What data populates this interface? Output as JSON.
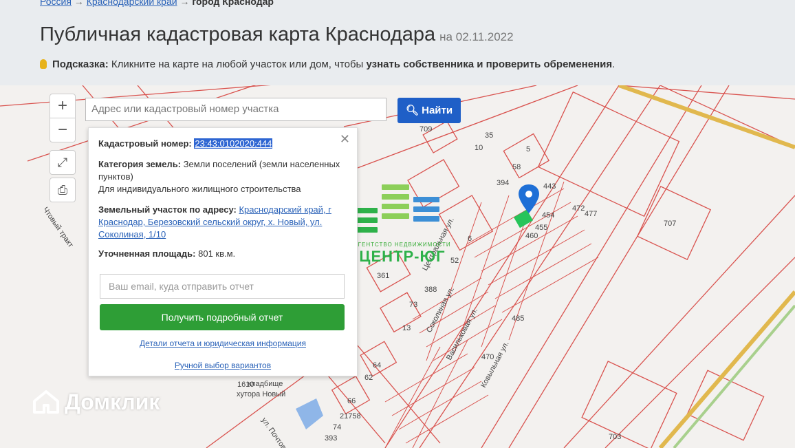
{
  "breadcrumb": {
    "part1": "Россия",
    "arrow1": " → ",
    "part2": "Краснодарский край",
    "arrow2": " → ",
    "part3": "город Краснодар"
  },
  "header": {
    "title": "Публичная кадастровая карта Краснодара",
    "date": "на 02.11.2022"
  },
  "hint": {
    "label": "Подсказка:",
    "text": "Кликните на карте на любой участок или дом, чтобы ",
    "bold": "узнать собственника и проверить обременения",
    "tail": "."
  },
  "map_controls": {
    "zoom_in": "+",
    "zoom_out": "−"
  },
  "search": {
    "placeholder": "Адрес или кадастровый номер участка",
    "button": "Найти"
  },
  "popup": {
    "cadastral_label": "Кадастровый номер:",
    "cadastral_value": "23:43:0102020:444",
    "category_label": "Категория земель:",
    "category_value": "Земли поселений (земли населенных пунктов)",
    "category_use": "Для индивидуального жилищного строительства",
    "address_label": "Земельный участок по адресу:",
    "address_value": "Краснодарский край, г Краснодар, Березовский сельский округ, х. Новый, ул. Соколиная, 1/10",
    "area_label": "Уточненная площадь:",
    "area_value": "801 кв.м.",
    "email_placeholder": "Ваш email, куда отправить отчет",
    "report_button": "Получить подробный отчет",
    "details_link": "Детали отчета и юридическая информация",
    "manual_link": "Ручной выбор вариантов"
  },
  "agency_logo": {
    "caption": "АГЕНТСТВО НЕДВИЖИМОСТИ",
    "name": "ЦЕНТР-ЮГ"
  },
  "watermark": {
    "text": "Домклик"
  },
  "map_labels": {
    "n709": "709",
    "n707": "707",
    "n703": "703",
    "n35": "35",
    "n10": "10",
    "n5": "5",
    "n58": "58",
    "n394": "394",
    "n6": "6",
    "n52": "52",
    "n361": "361",
    "n388": "388",
    "n73": "73",
    "n13": "13",
    "n64": "64",
    "n62": "62",
    "n66": "66",
    "n21758": "21758",
    "n74": "74",
    "n393": "393",
    "n443": "443",
    "n454": "454",
    "n455": "455",
    "n460": "460",
    "n485": "485",
    "n470": "470",
    "n472": "472",
    "n477": "477",
    "n1610": "1610",
    "st_center": "Центральная ул.",
    "st_sokol": "Соколиная ул.",
    "st_vasil": "Васильковая ул.",
    "st_koval": "Ковыльная ул.",
    "st_trakt": "Чтовый тракт",
    "st_pochtov": "ул. Почтовый",
    "cemetery": "кладбище",
    "khutor": "хутора Новый"
  }
}
